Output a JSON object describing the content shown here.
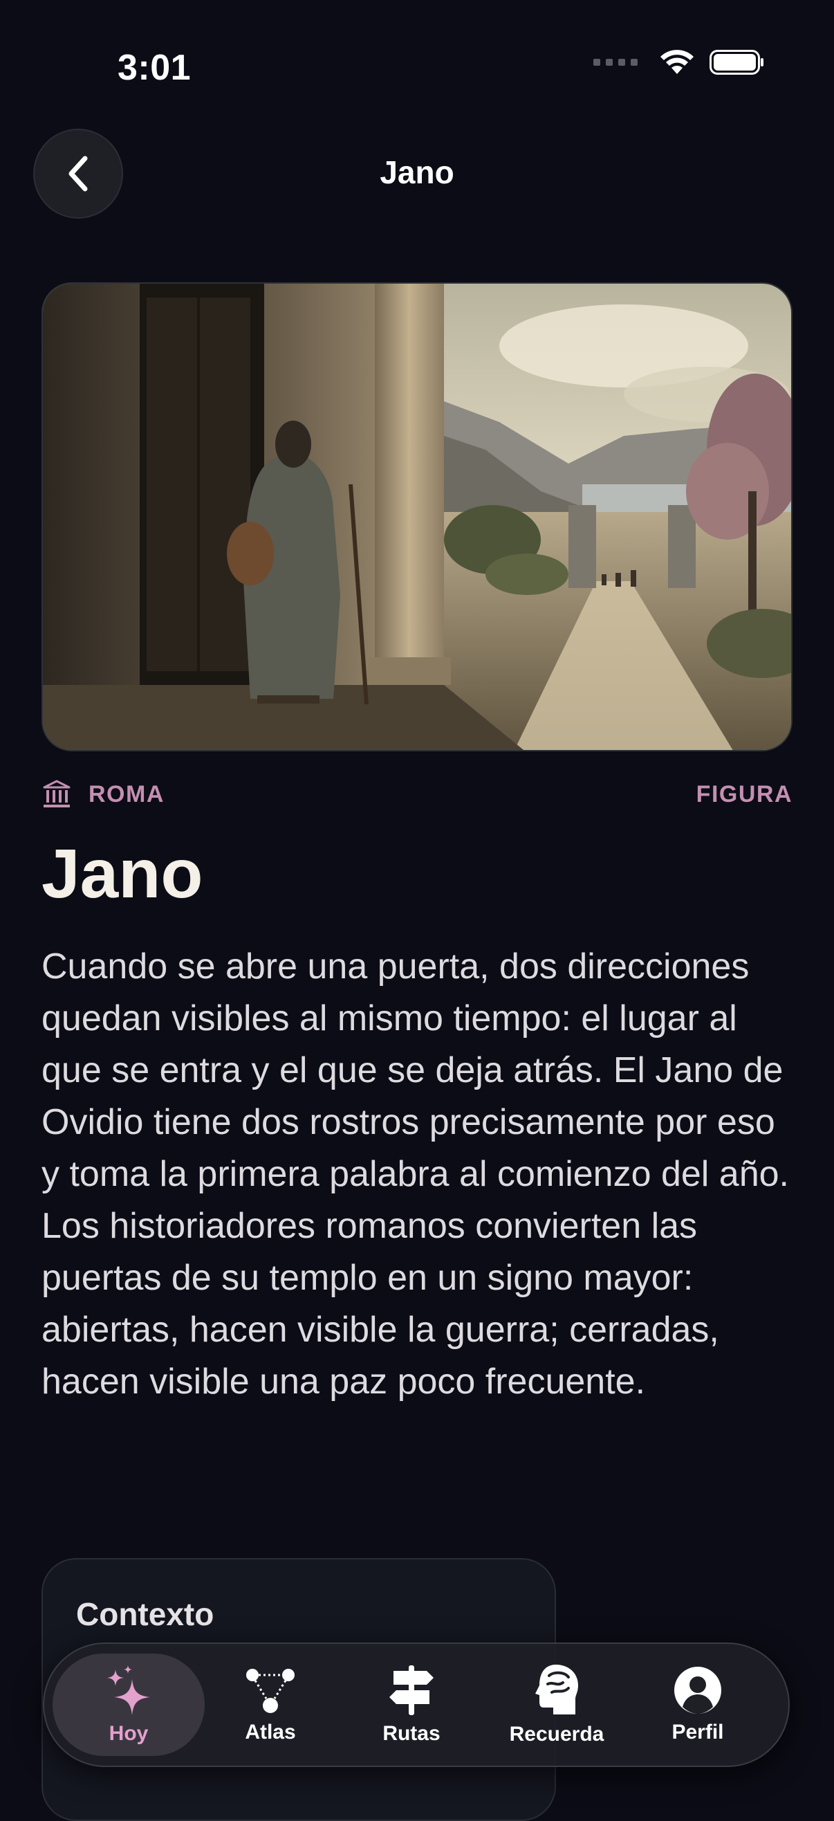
{
  "status": {
    "time": "3:01"
  },
  "header": {
    "title": "Jano"
  },
  "meta": {
    "icon": "temple-icon",
    "region": "ROMA",
    "category": "FIGURA"
  },
  "article": {
    "title": "Jano",
    "body": "Cuando se abre una puerta, dos direcciones quedan visibles al mismo tiempo: el lugar al que se entra y el que se deja atrás. El Jano de Ovidio tiene dos rostros precisamente por eso y toma la primera palabra al comienzo del año. Los historiadores romanos convierten las puertas de su templo en un signo mayor: abiertas, hacen visible la guerra; cerradas, hacen visible una paz poco frecuente."
  },
  "context_card": {
    "title": "Contexto"
  },
  "tabs": [
    {
      "label": "Hoy",
      "icon": "sparkles-icon",
      "active": true
    },
    {
      "label": "Atlas",
      "icon": "network-icon",
      "active": false
    },
    {
      "label": "Rutas",
      "icon": "signpost-icon",
      "active": false
    },
    {
      "label": "Recuerda",
      "icon": "brain-head-icon",
      "active": false
    },
    {
      "label": "Perfil",
      "icon": "person-icon",
      "active": false
    }
  ],
  "colors": {
    "background": "#0b0c15",
    "accent": "#c48fb2",
    "active_tab_label": "#e3a1cd"
  }
}
